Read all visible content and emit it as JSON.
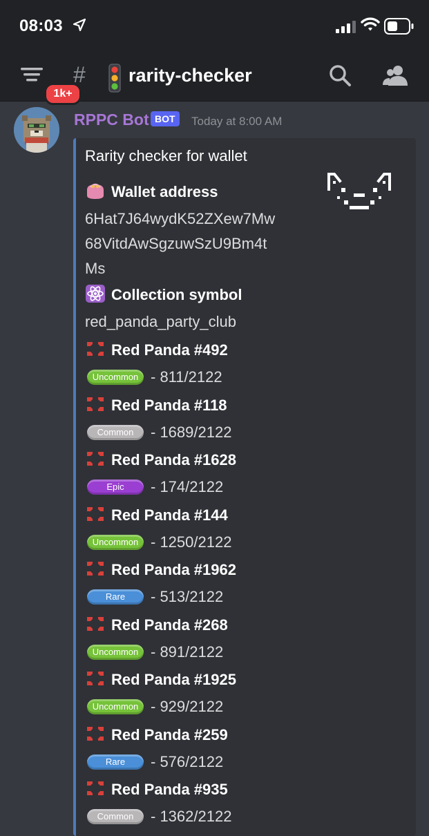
{
  "status_bar": {
    "time": "08:03"
  },
  "header": {
    "badge": "1k+",
    "hash": "#",
    "channel": "rarity-checker"
  },
  "message": {
    "author": "RPPC Bot",
    "bot_tag": "BOT",
    "timestamp": "Today at 8:00 AM",
    "embed": {
      "title": "Rarity checker for wallet",
      "wallet_label": "Wallet address",
      "wallet_lines": [
        "6Hat7J64wydK52ZXew7Mw",
        "68VitdAwSgzuwSzU9Bm4t",
        "Ms"
      ],
      "collection_label": "Collection symbol",
      "collection_value": "red_panda_party_club",
      "pandas": [
        {
          "name": "Red Panda #492",
          "rarity": "Uncommon",
          "rank": "- 811/2122"
        },
        {
          "name": "Red Panda #118",
          "rarity": "Common",
          "rank": "- 1689/2122"
        },
        {
          "name": "Red Panda #1628",
          "rarity": "Epic",
          "rank": "- 174/2122"
        },
        {
          "name": "Red Panda #144",
          "rarity": "Uncommon",
          "rank": "- 1250/2122"
        },
        {
          "name": "Red Panda #1962",
          "rarity": "Rare",
          "rank": "- 513/2122"
        },
        {
          "name": "Red Panda #268",
          "rarity": "Uncommon",
          "rank": "- 891/2122"
        },
        {
          "name": "Red Panda #1925",
          "rarity": "Uncommon",
          "rank": "- 929/2122"
        },
        {
          "name": "Red Panda #259",
          "rarity": "Rare",
          "rank": "- 576/2122"
        },
        {
          "name": "Red Panda #935",
          "rarity": "Common",
          "rank": "- 1362/2122"
        }
      ]
    }
  },
  "colors": {
    "background": "#36393f",
    "header": "#202225",
    "embed_bg": "#2f3136",
    "embed_border": "#4e7ab8",
    "author": "#a776d6",
    "bot_tag": "#5865f2",
    "badge": "#ed4245",
    "uncommon": "#76c23a",
    "common": "#b9b6b8",
    "epic": "#9a3fd1",
    "rare": "#4a8fd8"
  },
  "icons": [
    "location-arrow-icon",
    "signal-icon",
    "wifi-icon",
    "battery-icon",
    "channels-menu-icon",
    "traffic-light-icon",
    "search-icon",
    "members-icon",
    "purse-icon",
    "atom-icon",
    "anger-icon"
  ]
}
